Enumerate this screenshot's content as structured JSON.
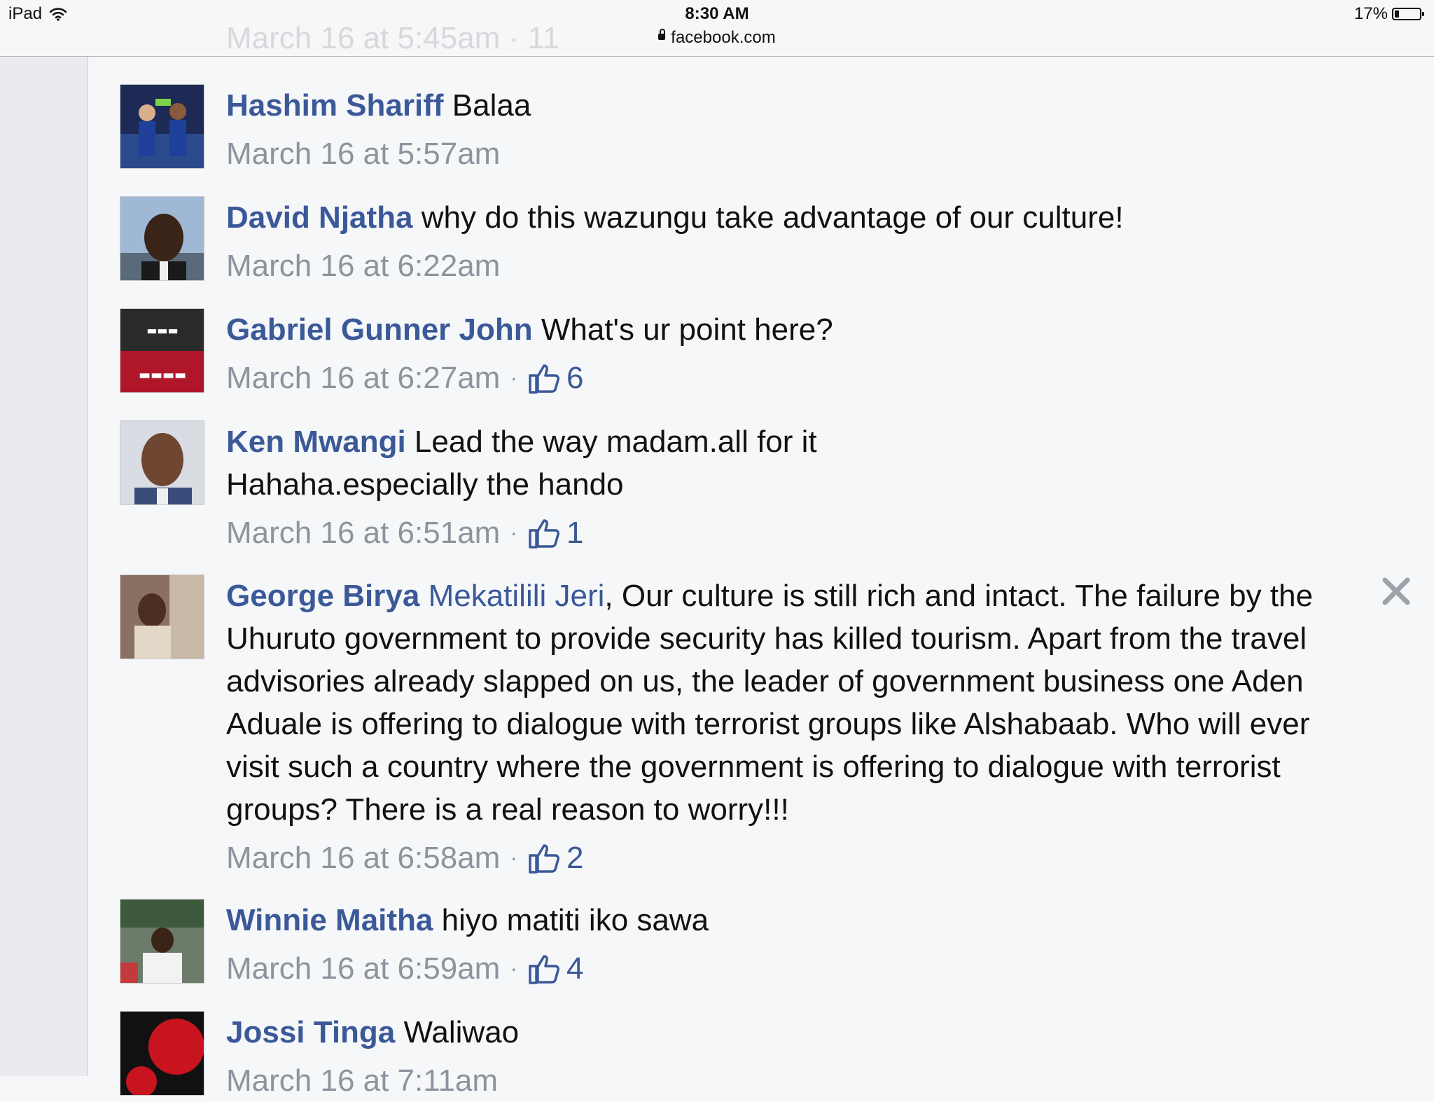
{
  "status_bar": {
    "device": "iPad",
    "time": "8:30 AM",
    "url": "facebook.com",
    "battery": "17%",
    "battery_level": 0.17
  },
  "ghost_previous": "March 16 at 5:45am · 11",
  "comments": [
    {
      "author": "Hashim Shariff",
      "mention": "",
      "text": "Balaa",
      "timestamp": "March 16 at 5:57am",
      "likes": ""
    },
    {
      "author": "David Njatha",
      "mention": "",
      "text": "why do this wazungu take advantage of our culture!",
      "timestamp": "March 16 at 6:22am",
      "likes": ""
    },
    {
      "author": "Gabriel Gunner John",
      "mention": "",
      "text": "What's ur point here?",
      "timestamp": "March 16 at 6:27am",
      "likes": "6"
    },
    {
      "author": "Ken Mwangi",
      "mention": "",
      "text": "Lead the way madam.all for it Hahaha.especially the hando",
      "timestamp": "March 16 at 6:51am",
      "likes": "1"
    },
    {
      "author": "George Birya",
      "mention": "Mekatilili Jeri",
      "text": ", Our culture is still rich and intact. The failure by the Uhuruto government to provide security has killed tourism. Apart from the travel advisories already slapped on us, the leader of government business one Aden Aduale is offering to dialogue with terrorist groups like Alshabaab. Who will ever visit such a country where the government is offering to dialogue with terrorist groups? There is a real reason to worry!!!",
      "timestamp": "March 16 at 6:58am",
      "likes": "2"
    },
    {
      "author": "Winnie Maitha",
      "mention": "",
      "text": "hiyo matiti iko sawa",
      "timestamp": "March 16 at 6:59am",
      "likes": "4"
    },
    {
      "author": "Jossi Tinga",
      "mention": "",
      "text": "Waliwao",
      "timestamp": "March 16 at 7:11am",
      "likes": ""
    }
  ],
  "colors": {
    "link": "#3b5998",
    "meta": "#8d949e",
    "background": "#f6f7f9"
  }
}
